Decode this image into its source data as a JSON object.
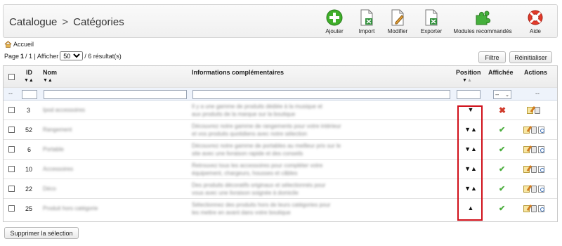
{
  "header": {
    "section": "Catalogue",
    "separator": ">",
    "page": "Catégories"
  },
  "toolbar": [
    {
      "id": "add",
      "label": "Ajouter",
      "icon": "plus-circle-icon"
    },
    {
      "id": "import",
      "label": "Import",
      "icon": "excel-import-icon"
    },
    {
      "id": "edit",
      "label": "Modifier",
      "icon": "edit-document-icon"
    },
    {
      "id": "export",
      "label": "Exporter",
      "icon": "excel-export-icon"
    },
    {
      "id": "modules",
      "label": "Modules recommandés",
      "icon": "puzzle-icon"
    },
    {
      "id": "help",
      "label": "Aide",
      "icon": "lifebuoy-icon"
    }
  ],
  "breadcrumb": {
    "home_label": "Accueil",
    "icon": "home-icon"
  },
  "pager": {
    "page_label": "Page",
    "current": "1",
    "separator": "/ 1 | Afficher",
    "per_page": "50",
    "results": "/ 6 résultat(s)"
  },
  "buttons": {
    "filter": "Filtre",
    "reset": "Réinitialiser",
    "delete_selection": "Supprimer la sélection"
  },
  "columns": {
    "id": "ID",
    "name": "Nom",
    "info": "Informations complémentaires",
    "position": "Position",
    "displayed": "Affichée",
    "actions": "Actions"
  },
  "filters": {
    "checkbox_placeholder": "--",
    "displayed_select": "--",
    "actions_placeholder": "--"
  },
  "rows": [
    {
      "id": "3",
      "name": "Ipod accessoires",
      "info": [
        "Il y a une gamme de produits dédiée à la musique et",
        "aux produits de la marque sur la boutique"
      ],
      "position": "down",
      "displayed": false
    },
    {
      "id": "52",
      "name": "Rangement",
      "info": [
        "Découvrez notre gamme de rangements pour votre intérieur",
        "et vos produits quotidiens avec notre sélection"
      ],
      "position": "both",
      "displayed": true
    },
    {
      "id": "6",
      "name": "Portable",
      "info": [
        "Découvrez notre gamme de portables au meilleur prix sur le",
        "site avec une livraison rapide et des conseils"
      ],
      "position": "both",
      "displayed": true
    },
    {
      "id": "10",
      "name": "Accessoires",
      "info": [
        "Retrouvez tous les accessoires pour compléter votre",
        "équipement, chargeurs, housses et câbles"
      ],
      "position": "both",
      "displayed": true
    },
    {
      "id": "22",
      "name": "Déco",
      "info": [
        "Des produits décoratifs originaux et sélectionnés pour",
        "vous avec une livraison soignée à domicile"
      ],
      "position": "both",
      "displayed": true
    },
    {
      "id": "25",
      "name": "Produit hors catégorie",
      "info": [
        "Sélectionnez des produits hors de leurs catégories pour",
        "les mettre en avant dans votre boutique"
      ],
      "position": "up",
      "displayed": true
    }
  ],
  "colors": {
    "highlight": "#d0101a",
    "check": "#4cae3e",
    "cross": "#d03a2a"
  }
}
